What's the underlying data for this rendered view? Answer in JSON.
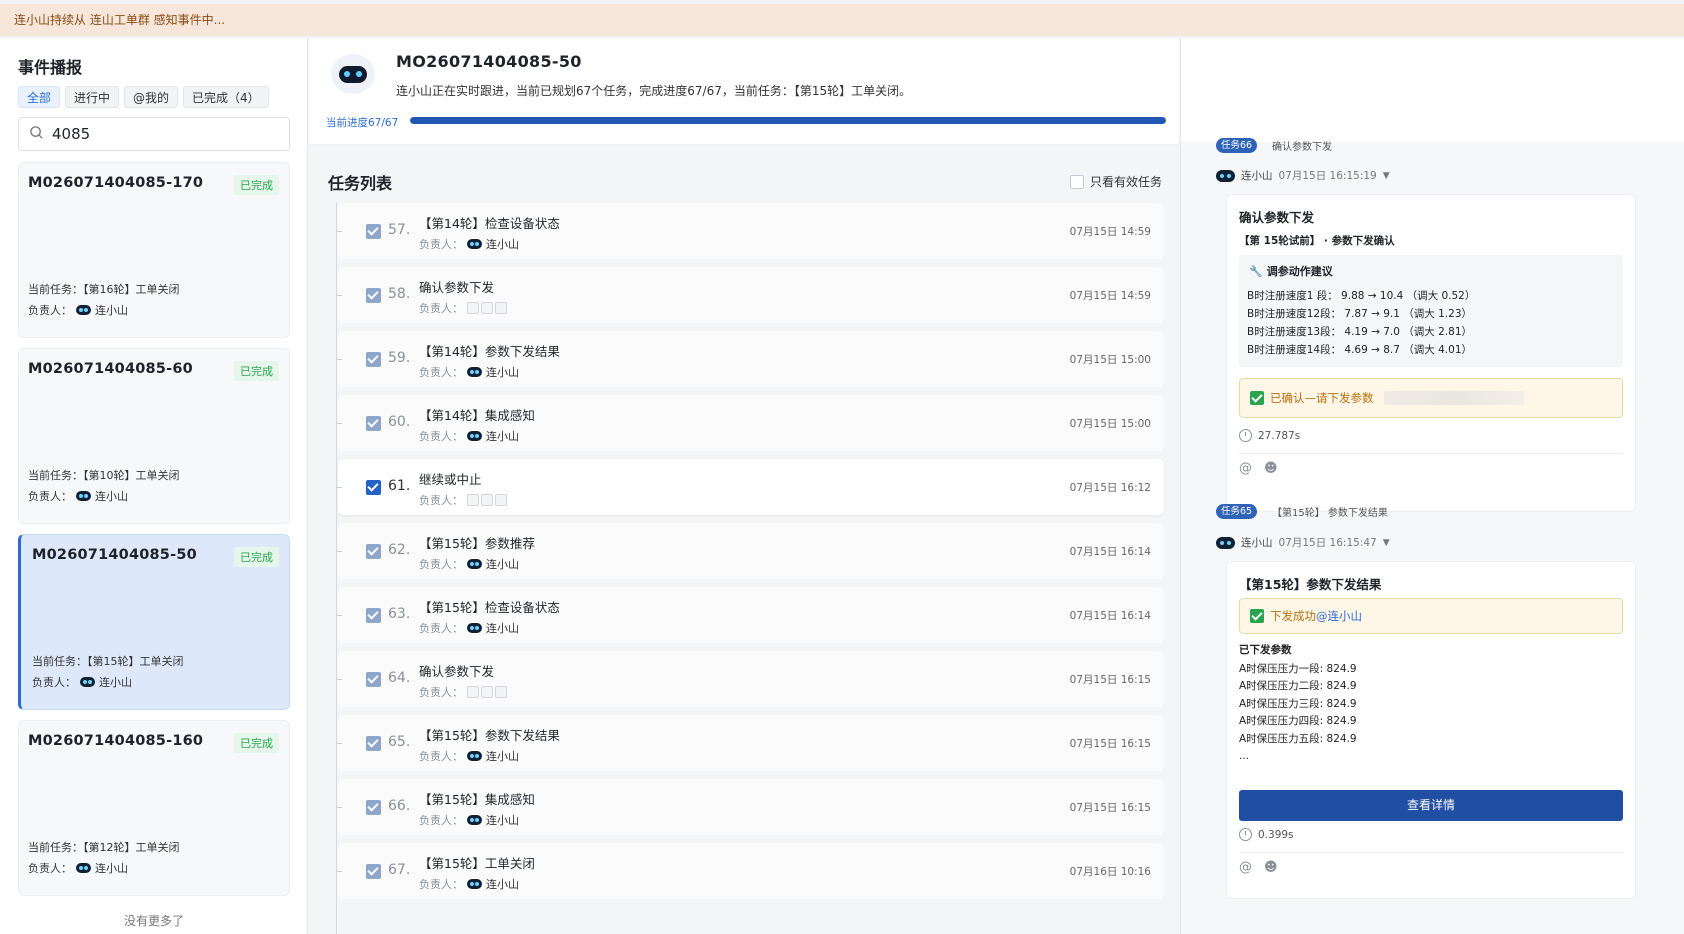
{
  "banner": "连小山持续从 连山工单群 感知事件中...",
  "left": {
    "title": "事件播报",
    "filters": [
      "全部",
      "进行中",
      "@我的",
      "已完成（4）"
    ],
    "search_value": "4085",
    "cards": [
      {
        "id": "M026071404085-170",
        "badge": "已完成",
        "task": "当前任务：【第16轮】工单关闭",
        "owner_label": "负责人：",
        "owner": "连小山"
      },
      {
        "id": "M026071404085-60",
        "badge": "已完成",
        "task": "当前任务：【第10轮】工单关闭",
        "owner_label": "负责人：",
        "owner": "连小山"
      },
      {
        "id": "M026071404085-50",
        "badge": "已完成",
        "task": "当前任务：【第15轮】工单关闭",
        "owner_label": "负责人：",
        "owner": "连小山"
      },
      {
        "id": "M026071404085-160",
        "badge": "已完成",
        "task": "当前任务：【第12轮】工单关闭",
        "owner_label": "负责人：",
        "owner": "连小山"
      }
    ],
    "no_more": "没有更多了"
  },
  "header": {
    "work_order": "MO26071404085-50",
    "status": "连小山正在实时跟进，当前已规划67个任务，完成进度67/67，当前任务：【第15轮】工单关闭。",
    "progress_label": "当前进度67/67",
    "progress": 1.0
  },
  "list": {
    "title": "任务列表",
    "only_valid": "只看有效任务",
    "owner_label": "负责人：",
    "tasks": [
      {
        "num": "57.",
        "name": "【第14轮】检查设备状态",
        "owner": "连小山",
        "time": "07月15日 14:59"
      },
      {
        "num": "58.",
        "name": "确认参数下发",
        "owner": "",
        "time": "07月15日 14:59"
      },
      {
        "num": "59.",
        "name": "【第14轮】参数下发结果",
        "owner": "连小山",
        "time": "07月15日 15:00"
      },
      {
        "num": "60.",
        "name": "【第14轮】集成感知",
        "owner": "连小山",
        "time": "07月15日 15:00"
      },
      {
        "num": "61.",
        "name": "继续或中止",
        "owner": "",
        "time": "07月15日 16:12"
      },
      {
        "num": "62.",
        "name": "【第15轮】参数推荐",
        "owner": "连小山",
        "time": "07月15日 16:14"
      },
      {
        "num": "63.",
        "name": "【第15轮】检查设备状态",
        "owner": "连小山",
        "time": "07月15日 16:14"
      },
      {
        "num": "64.",
        "name": "确认参数下发",
        "owner": "",
        "time": "07月15日 16:15"
      },
      {
        "num": "65.",
        "name": "【第15轮】参数下发结果",
        "owner": "连小山",
        "time": "07月15日 16:15"
      },
      {
        "num": "66.",
        "name": "【第15轮】集成感知",
        "owner": "连小山",
        "time": "07月15日 16:15"
      },
      {
        "num": "67.",
        "name": "【第15轮】工单关闭",
        "owner": "连小山",
        "time": "07月16日 10:16"
      }
    ]
  },
  "right": {
    "msg1": {
      "chip": "任务66",
      "label": "确认参数下发",
      "author": "连小山",
      "time": "07月15日 16:15:19",
      "title": "确认参数下发",
      "subtitle": "【第 15轮试前】 · 参数下发确认",
      "adj_title": "调参动作建议",
      "adj_lines": [
        "B时注册速度1 段：  9.88 → 10.4 （调大 0.52）",
        "B时注册速度12段：  7.87 → 9.1 （调大 1.23）",
        "B时注册速度13段：  4.19 → 7.0 （调大 2.81）",
        "B时注册速度14段：  4.69 → 8.7 （调大 4.01）"
      ],
      "confirm": "已确认—请下发参数",
      "duration": "27.787s"
    },
    "msg2": {
      "chip": "任务65",
      "label": "【第15轮】 参数下发结果",
      "author": "连小山",
      "time": "07月15日 16:15:47",
      "title": "【第15轮】参数下发结果",
      "success": "下发成功",
      "mention": "@连小山",
      "params_title": "已下发参数",
      "params": [
        "A时保压压力一段: 824.9",
        "A时保压压力二段: 824.9",
        "A时保压压力三段: 824.9",
        "A时保压压力四段: 824.9",
        "A时保压压力五段: 824.9",
        "..."
      ],
      "detail_button": "查看详情",
      "duration": "0.399s"
    }
  }
}
